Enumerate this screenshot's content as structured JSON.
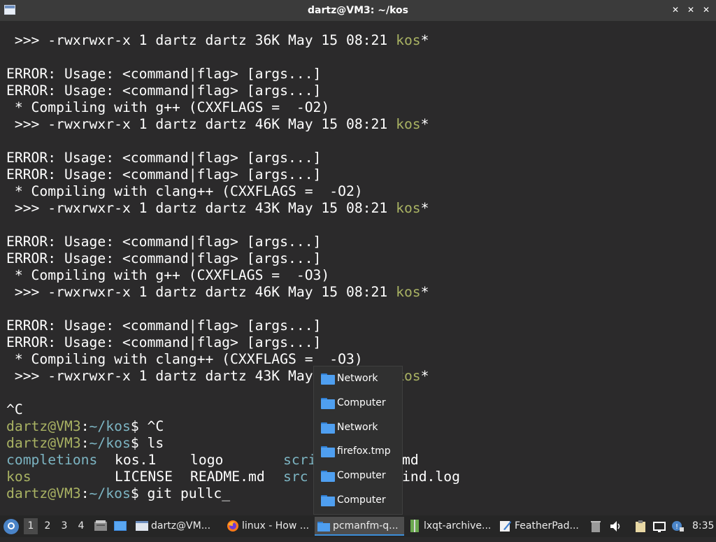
{
  "window": {
    "title": "dartz@VM3: ~/kos",
    "controls": [
      "minimize",
      "maximize",
      "close"
    ]
  },
  "terminal": {
    "lines": [
      {
        "t": " >>> -rwxrwxr-x 1 dartz dartz 36K May 15 08:21 ",
        "g": "kos",
        "s": "*"
      },
      {
        "t": ""
      },
      {
        "t": "ERROR: Usage: <command|flag> [args...]"
      },
      {
        "t": "ERROR: Usage: <command|flag> [args...]"
      },
      {
        "t": " * Compiling with g++ (CXXFLAGS =  -O2)"
      },
      {
        "t": " >>> -rwxrwxr-x 1 dartz dartz 46K May 15 08:21 ",
        "g": "kos",
        "s": "*"
      },
      {
        "t": ""
      },
      {
        "t": "ERROR: Usage: <command|flag> [args...]"
      },
      {
        "t": "ERROR: Usage: <command|flag> [args...]"
      },
      {
        "t": " * Compiling with clang++ (CXXFLAGS =  -O2)"
      },
      {
        "t": " >>> -rwxrwxr-x 1 dartz dartz 43K May 15 08:21 ",
        "g": "kos",
        "s": "*"
      },
      {
        "t": ""
      },
      {
        "t": "ERROR: Usage: <command|flag> [args...]"
      },
      {
        "t": "ERROR: Usage: <command|flag> [args...]"
      },
      {
        "t": " * Compiling with g++ (CXXFLAGS =  -O3)"
      },
      {
        "t": " >>> -rwxrwxr-x 1 dartz dartz 46K May 15 08:21 ",
        "g": "kos",
        "s": "*"
      },
      {
        "t": ""
      },
      {
        "t": "ERROR: Usage: <command|flag> [args...]"
      },
      {
        "t": "ERROR: Usage: <command|flag> [args...]"
      },
      {
        "t": " * Compiling with clang++ (CXXFLAGS =  -O3)"
      },
      {
        "t": " >>> -rwxrwxr-x 1 dartz dartz 43K May 15 08:21 ",
        "g": "kos",
        "s": "*"
      },
      {
        "t": ""
      },
      {
        "t": "^C"
      }
    ],
    "prompt_user": "dartz@VM3",
    "prompt_sep": ":",
    "prompt_path": "~/kos",
    "prompt_end": "$ ",
    "cmd1": "^C",
    "cmd2": "ls",
    "ls_row1": {
      "a": "completions",
      "b": "kos.1",
      "c": "logo",
      "d": "scri",
      "e": "md"
    },
    "ls_row2": {
      "a": "kos",
      "b": "LICENSE",
      "c": "README.md",
      "d": "src",
      "e": "ind.log"
    },
    "cmd3": "git pullc",
    "cursor": "_"
  },
  "popup": {
    "items": [
      "Network",
      "Computer",
      "Network",
      "firefox.tmp",
      "Computer",
      "Computer"
    ]
  },
  "taskbar": {
    "desktops": [
      "1",
      "2",
      "3",
      "4"
    ],
    "active_desktop": "1",
    "tasks": [
      {
        "label": "dartz@VM...",
        "icon": "terminal-icon"
      },
      {
        "label": "linux - How ...",
        "icon": "firefox-icon"
      },
      {
        "label": "pcmanfm-q...",
        "icon": "folder-icon",
        "active": true
      },
      {
        "label": "lxqt-archive...",
        "icon": "archive-icon"
      },
      {
        "label": "FeatherPad...",
        "icon": "featherpad-icon"
      }
    ],
    "clock": "8:35"
  },
  "colors": {
    "terminal_bg": "#2b2a2b",
    "green": "#a9b263",
    "teal": "#7cb4c2",
    "folder_blue": "#4f9ff0",
    "taskbar_bg": "#262626",
    "accent": "#3c8ed9"
  }
}
